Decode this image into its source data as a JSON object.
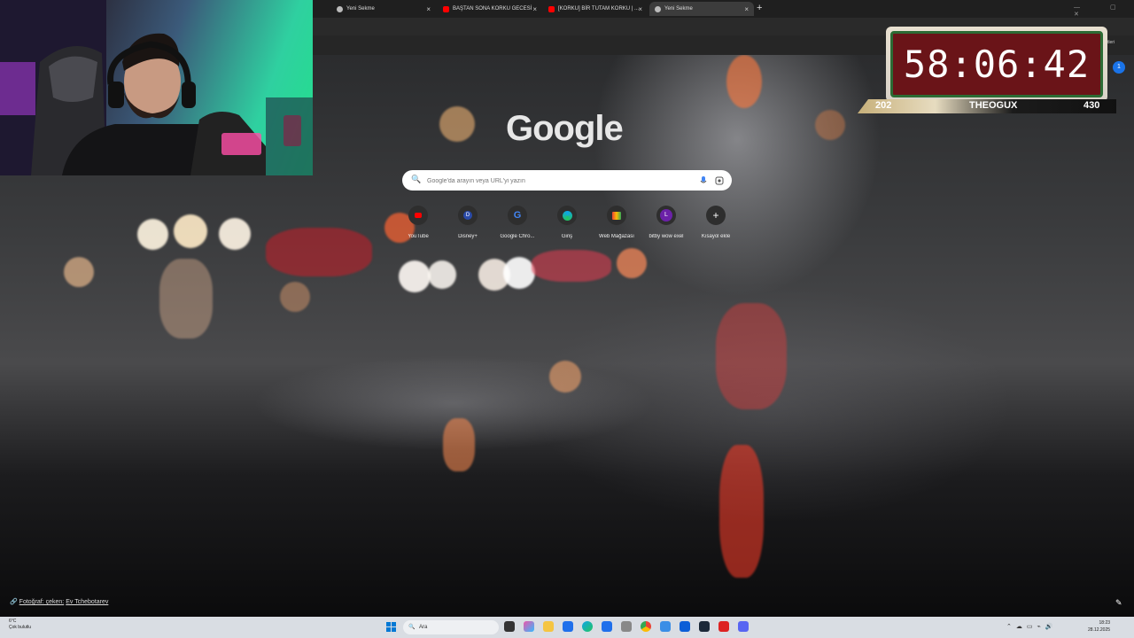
{
  "browser": {
    "tabs": [
      {
        "title": "Yeni Sekme",
        "icon": "chrome-icon",
        "active": false
      },
      {
        "title": "BAŞTAN SONA KORKU GECESİ",
        "icon": "youtube-icon",
        "active": false
      },
      {
        "title": "[KORKU] BİR TUTAM KORKU | ...",
        "icon": "youtube-icon",
        "active": false
      },
      {
        "title": "Yeni Sekme",
        "icon": "chrome-icon",
        "active": true
      }
    ],
    "new_tab_label": "+",
    "window_controls": "— ▢ ✕"
  },
  "ntp": {
    "logo": "Google",
    "search_placeholder": "Google'da arayın veya URL'yi yazın",
    "shortcuts": [
      {
        "label": "YouTube",
        "icon": "youtube-icon",
        "color": "#ff0000"
      },
      {
        "label": "Disney+",
        "icon": "disney-icon",
        "color": "#1e3a8a"
      },
      {
        "label": "Google Chro...",
        "icon": "google-icon",
        "color": "#4285f4"
      },
      {
        "label": "Giriş",
        "icon": "edge-icon",
        "color": "#0ea5e9"
      },
      {
        "label": "Web Mağazası",
        "icon": "webstore-icon",
        "color": "#ea4335"
      },
      {
        "label": "bitby wow exel",
        "icon": "letter-l-icon",
        "color": "#6b21a8"
      },
      {
        "label": "Kısayol ekle",
        "icon": "plus-icon",
        "color": "#3a3a3a"
      }
    ],
    "photo_credit_prefix": "Fotoğraf: çeken:",
    "photo_credit_name": "Ev Tchebotarev"
  },
  "overlay": {
    "timer": "58:06:42",
    "left_count": "202",
    "streamer": "THEOGUX",
    "right_count": "430"
  },
  "extension": {
    "badge": "1",
    "label": "ögretleri"
  },
  "taskbar": {
    "weather_temp": "6°C",
    "weather_desc": "Çok bulutlu",
    "search_label": "Ara",
    "time": "18:23",
    "date": "28.12.2025"
  }
}
